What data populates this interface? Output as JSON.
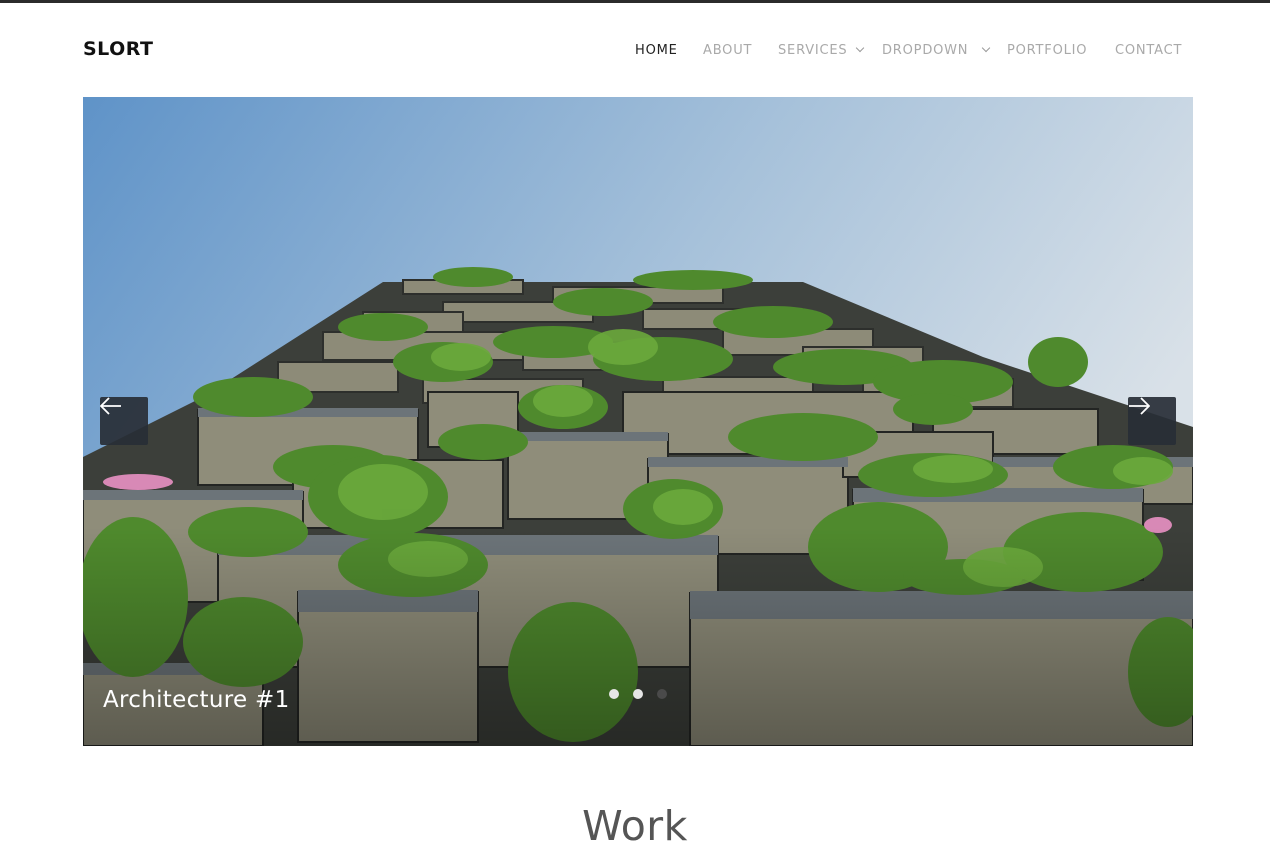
{
  "brand": {
    "logo": "SLORT"
  },
  "nav": {
    "items": [
      {
        "label": "HOME",
        "active": true,
        "has_dropdown": false
      },
      {
        "label": "ABOUT",
        "active": false,
        "has_dropdown": false
      },
      {
        "label": "SERVICES",
        "active": false,
        "has_dropdown": true
      },
      {
        "label": "DROPDOWN",
        "active": false,
        "has_dropdown": true
      },
      {
        "label": "PORTFOLIO",
        "active": false,
        "has_dropdown": false
      },
      {
        "label": "CONTACT",
        "active": false,
        "has_dropdown": false
      }
    ]
  },
  "slider": {
    "caption": "Architecture #1",
    "prev_icon": "arrow-left-icon",
    "next_icon": "arrow-right-icon",
    "slide_count": 3,
    "active_slide": 1
  },
  "section": {
    "title": "Work"
  },
  "colors": {
    "accent": "#222222",
    "nav_inactive": "#a9a9a9",
    "arrow_bg": "#282e36"
  }
}
